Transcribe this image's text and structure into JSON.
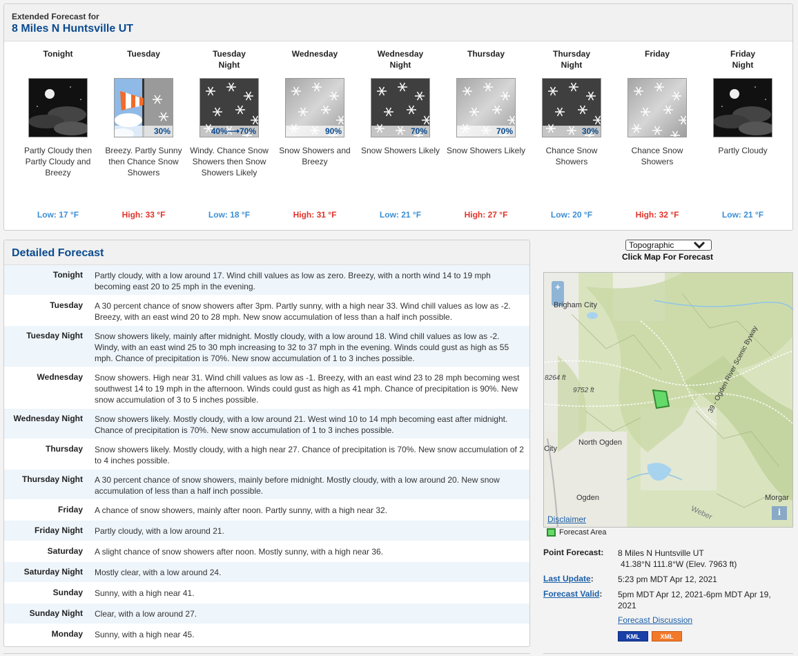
{
  "extended": {
    "pre_title": "Extended Forecast for",
    "location": "8 Miles N Huntsville UT",
    "periods": [
      {
        "name": "Tonight",
        "icon": "night-partly-cloudy-icon",
        "pop": "",
        "desc": "Partly Cloudy then Partly Cloudy and Breezy",
        "temp": "Low: 17 °F",
        "kind": "low"
      },
      {
        "name": "Tuesday",
        "icon": "breezy-snow-icon",
        "pop": "30%",
        "desc": "Breezy. Partly Sunny then Chance Snow Showers",
        "temp": "High: 33 °F",
        "kind": "high"
      },
      {
        "name": "Tuesday Night",
        "icon": "snow-night-icon",
        "pop": "40%⟶70%",
        "desc": "Windy. Chance Snow Showers then Snow Showers Likely",
        "temp": "Low: 18 °F",
        "kind": "low"
      },
      {
        "name": "Wednesday",
        "icon": "snow-icon",
        "pop": "90%",
        "desc": "Snow Showers and Breezy",
        "temp": "High: 31 °F",
        "kind": "high"
      },
      {
        "name": "Wednesday Night",
        "icon": "snow-night-icon",
        "pop": "70%",
        "desc": "Snow Showers Likely",
        "temp": "Low: 21 °F",
        "kind": "low"
      },
      {
        "name": "Thursday",
        "icon": "snow-icon",
        "pop": "70%",
        "desc": "Snow Showers Likely",
        "temp": "High: 27 °F",
        "kind": "high"
      },
      {
        "name": "Thursday Night",
        "icon": "snow-night-icon",
        "pop": "30%",
        "desc": "Chance Snow Showers",
        "temp": "Low: 20 °F",
        "kind": "low"
      },
      {
        "name": "Friday",
        "icon": "snow-icon",
        "pop": "",
        "desc": "Chance Snow Showers",
        "temp": "High: 32 °F",
        "kind": "high"
      },
      {
        "name": "Friday Night",
        "icon": "night-partly-cloudy-icon",
        "pop": "",
        "desc": "Partly Cloudy",
        "temp": "Low: 21 °F",
        "kind": "low"
      }
    ]
  },
  "detailed": {
    "title": "Detailed Forecast",
    "rows": [
      {
        "label": "Tonight",
        "text": "Partly cloudy, with a low around 17. Wind chill values as low as zero. Breezy, with a north wind 14 to 19 mph becoming east 20 to 25 mph in the evening."
      },
      {
        "label": "Tuesday",
        "text": "A 30 percent chance of snow showers after 3pm. Partly sunny, with a high near 33. Wind chill values as low as -2. Breezy, with an east wind 20 to 28 mph. New snow accumulation of less than a half inch possible."
      },
      {
        "label": "Tuesday Night",
        "text": "Snow showers likely, mainly after midnight. Mostly cloudy, with a low around 18. Wind chill values as low as -2. Windy, with an east wind 25 to 30 mph increasing to 32 to 37 mph in the evening. Winds could gust as high as 55 mph. Chance of precipitation is 70%. New snow accumulation of 1 to 3 inches possible."
      },
      {
        "label": "Wednesday",
        "text": "Snow showers. High near 31. Wind chill values as low as -1. Breezy, with an east wind 23 to 28 mph becoming west southwest 14 to 19 mph in the afternoon. Winds could gust as high as 41 mph. Chance of precipitation is 90%. New snow accumulation of 3 to 5 inches possible."
      },
      {
        "label": "Wednesday Night",
        "text": "Snow showers likely. Mostly cloudy, with a low around 21. West wind 10 to 14 mph becoming east after midnight. Chance of precipitation is 70%. New snow accumulation of 1 to 3 inches possible."
      },
      {
        "label": "Thursday",
        "text": "Snow showers likely. Mostly cloudy, with a high near 27. Chance of precipitation is 70%. New snow accumulation of 2 to 4 inches possible."
      },
      {
        "label": "Thursday Night",
        "text": "A 30 percent chance of snow showers, mainly before midnight. Mostly cloudy, with a low around 20. New snow accumulation of less than a half inch possible."
      },
      {
        "label": "Friday",
        "text": "A chance of snow showers, mainly after noon. Partly sunny, with a high near 32."
      },
      {
        "label": "Friday Night",
        "text": "Partly cloudy, with a low around 21."
      },
      {
        "label": "Saturday",
        "text": "A slight chance of snow showers after noon. Mostly sunny, with a high near 36."
      },
      {
        "label": "Saturday Night",
        "text": "Mostly clear, with a low around 24."
      },
      {
        "label": "Sunday",
        "text": "Sunny, with a high near 41."
      },
      {
        "label": "Sunday Night",
        "text": "Clear, with a low around 27."
      },
      {
        "label": "Monday",
        "text": "Sunny, with a high near 45."
      }
    ]
  },
  "map": {
    "select_value": "Topographic",
    "caption": "Click Map For Forecast",
    "zoom_label": "+",
    "info_label": "i",
    "disclaimer": "Disclaimer",
    "legend": "Forecast Area",
    "labels": {
      "brigham": "Brigham City",
      "north_ogden": "North Ogden",
      "city": "City",
      "ogden": "Ogden",
      "morgan": "Morgar",
      "weber": "Weber",
      "byway": "39 - Ogden River Scenic Byway",
      "elev1": "8264 ft",
      "elev2": "9752 ft"
    }
  },
  "info": {
    "point_label": "Point Forecast:",
    "point_name": "8 Miles N Huntsville UT",
    "point_coords": "41.38°N 111.8°W (Elev. 7963 ft)",
    "update_label": "Last Update",
    "update_value": "5:23 pm MDT Apr 12, 2021",
    "valid_label": "Forecast Valid",
    "valid_value": "5pm MDT Apr 12, 2021-6pm MDT Apr 19, 2021",
    "discussion": "Forecast Discussion",
    "kml": "KML",
    "xml": "XML",
    "colon": ":"
  },
  "colors": {
    "accent": "#0a4b8f",
    "low_temp": "#3a8ed6",
    "high_temp": "#e0332a",
    "forecast_area": "#66d96b"
  }
}
